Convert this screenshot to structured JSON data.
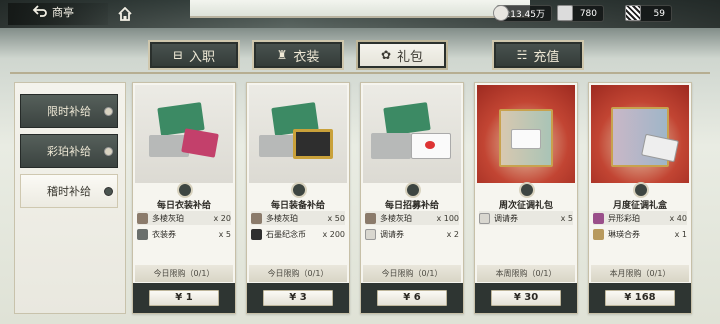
{
  "top": {
    "back_label": "商亭",
    "resources": [
      {
        "icon": "coin-icon",
        "value": "213.45万"
      },
      {
        "icon": "voucher-icon",
        "value": "780"
      },
      {
        "icon": "ticket-icon",
        "value": "59"
      }
    ]
  },
  "tabs": [
    {
      "glyph": "⊟",
      "label": "入职",
      "active": false
    },
    {
      "glyph": "♜",
      "label": "衣装",
      "active": false
    },
    {
      "glyph": "✿",
      "label": "礼包",
      "active": true
    },
    {
      "glyph": "☵",
      "label": "充值",
      "active": false
    }
  ],
  "side": [
    {
      "label": "限时补给",
      "active": false
    },
    {
      "label": "彩珀补给",
      "active": false
    },
    {
      "label": "稽时补给",
      "active": true
    }
  ],
  "cards": [
    {
      "title": "每日衣装补给",
      "items": [
        {
          "name": "多棱灰珀",
          "qty": "x 20"
        },
        {
          "name": "衣装券",
          "qty": "x 5"
        }
      ],
      "limit": "今日限购（0/1）",
      "price": "¥ 1"
    },
    {
      "title": "每日装备补给",
      "items": [
        {
          "name": "多棱灰珀",
          "qty": "x 50"
        },
        {
          "name": "石墨纪念币",
          "qty": "x 200"
        }
      ],
      "limit": "今日限购（0/1）",
      "price": "¥ 3"
    },
    {
      "title": "每日招募补给",
      "items": [
        {
          "name": "多棱灰珀",
          "qty": "x 100"
        },
        {
          "name": "调请券",
          "qty": "x 2"
        }
      ],
      "limit": "今日限购（0/1）",
      "price": "¥ 6"
    },
    {
      "title": "周次征调礼包",
      "items": [
        {
          "name": "调请券",
          "qty": "x 5"
        }
      ],
      "limit": "本周限购（0/1）",
      "price": "¥ 30"
    },
    {
      "title": "月度征调礼盒",
      "items": [
        {
          "name": "异形彩珀",
          "qty": "x 40"
        },
        {
          "name": "琳瑛合券",
          "qty": "x 1"
        }
      ],
      "limit": "本月限购（0/1）",
      "price": "¥ 168"
    }
  ],
  "colors": {
    "accent": "#3b4340",
    "panel": "#f6f5ef",
    "gift_bg": "#c24533"
  }
}
